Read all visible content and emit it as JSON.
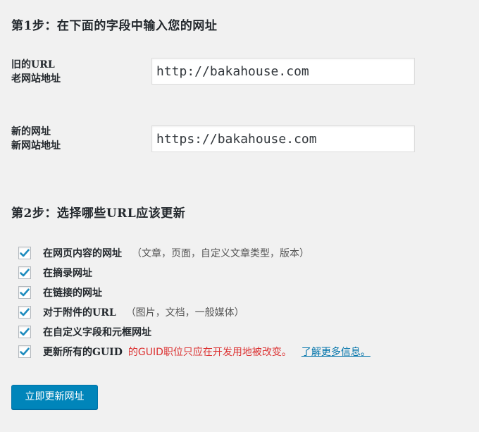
{
  "step1": {
    "title": "第1步：在下面的字段中输入您的网址",
    "old_url": {
      "label_line1": "旧的URL",
      "label_line2": "老网站地址",
      "value": "http://bakahouse.com"
    },
    "new_url": {
      "label_line1": "新的网址",
      "label_line2": "新网站地址",
      "value": "https://bakahouse.com"
    }
  },
  "step2": {
    "title": "第2步：选择哪些URL应该更新",
    "options": [
      {
        "label": "在网页内容的网址",
        "note": "（文章，页面，自定义文章类型，版本）",
        "checked": true
      },
      {
        "label": "在摘录网址",
        "checked": true
      },
      {
        "label": "在链接的网址",
        "checked": true
      },
      {
        "label": "对于附件的URL",
        "note": "（图片，文档，一般媒体）",
        "checked": true
      },
      {
        "label": "在自定义字段和元框网址",
        "checked": true
      },
      {
        "label": "更新所有的GUID",
        "warning": "的GUID职位只应在开发用地被改变。",
        "link": "了解更多信息。",
        "checked": true
      }
    ]
  },
  "submit_label": "立即更新网址",
  "colors": {
    "checkmark": "#1e8cbe",
    "button": "#0085ba",
    "warning": "#dc3232",
    "link": "#0073aa"
  },
  "icons": {
    "checkbox_checked": "checkmark-icon"
  }
}
